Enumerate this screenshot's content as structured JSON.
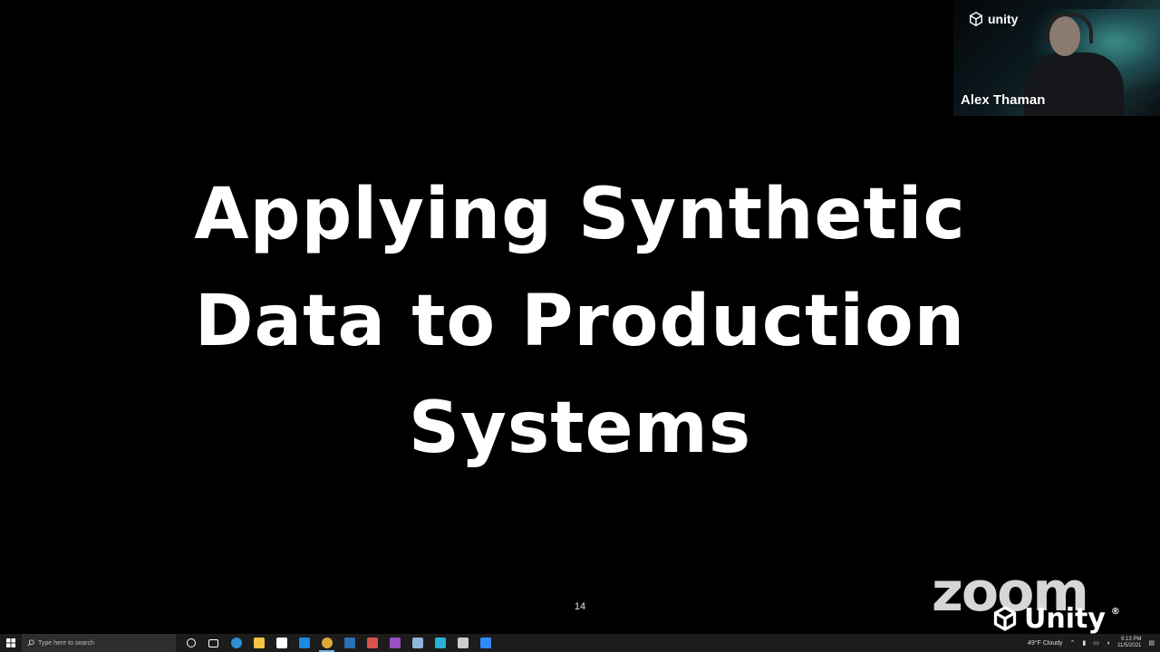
{
  "slide": {
    "title_lines": [
      "Applying Synthetic",
      "Data to Production",
      "Systems"
    ],
    "page_number": "14"
  },
  "webcam": {
    "badge_text": "unity",
    "speaker_name": "Alex Thaman"
  },
  "watermarks": {
    "zoom": "zoom",
    "unity": "Unity"
  },
  "taskbar": {
    "search_placeholder": "Type here to search",
    "apps": [
      {
        "name": "cortana",
        "color": "#ffffff"
      },
      {
        "name": "task-view",
        "color": "#ffffff"
      },
      {
        "name": "edge",
        "color": "#2d8fd5"
      },
      {
        "name": "file-explorer",
        "color": "#f4c542"
      },
      {
        "name": "store",
        "color": "#ffffff"
      },
      {
        "name": "mail",
        "color": "#1e88e5"
      },
      {
        "name": "chrome",
        "color": "#e0a83b"
      },
      {
        "name": "app-blue",
        "color": "#2a6fb8"
      },
      {
        "name": "app-red",
        "color": "#d9534f"
      },
      {
        "name": "onenote",
        "color": "#9b4fc4"
      },
      {
        "name": "notepad",
        "color": "#8fb6d8"
      },
      {
        "name": "app-teal",
        "color": "#2ab0d9"
      },
      {
        "name": "terminal",
        "color": "#cccccc"
      },
      {
        "name": "zoom",
        "color": "#2d8cff"
      }
    ],
    "weather": "49°F Cloudy",
    "time": "9:13 PM",
    "date": "11/5/2021"
  }
}
